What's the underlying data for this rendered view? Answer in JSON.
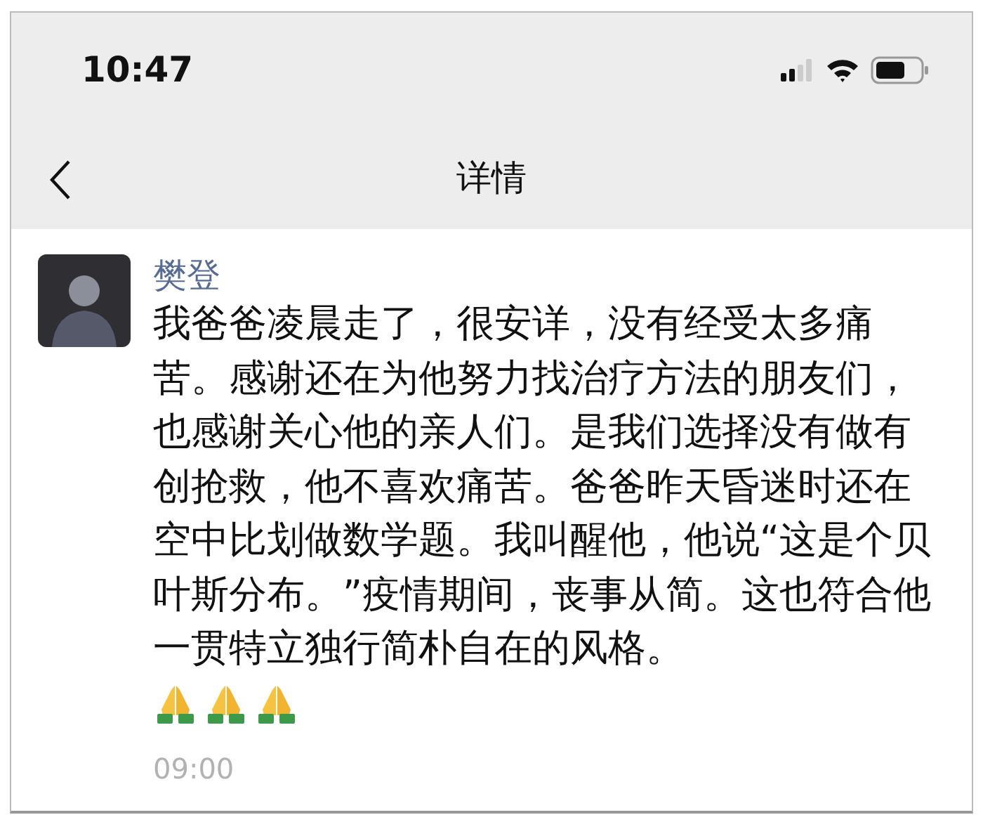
{
  "status_bar": {
    "time": "10:47"
  },
  "nav": {
    "title": "详情"
  },
  "post": {
    "author": "樊登",
    "text": "我爸爸凌晨走了，很安详，没有经受太多痛苦。感谢还在为他努力找治疗方法的朋友们，也感谢关心他的亲人们。是我们选择没有做有创抢救，他不喜欢痛苦。爸爸昨天昏迷时还在空中比划做数学题。我叫醒他，他说“这是个贝叶斯分布。”疫情期间，丧事从简。这也符合他一贯特立独行简朴自在的风格。",
    "emoji": [
      {
        "kind": "folded-hands"
      },
      {
        "kind": "folded-hands"
      },
      {
        "kind": "folded-hands"
      }
    ],
    "time": "09:00"
  }
}
